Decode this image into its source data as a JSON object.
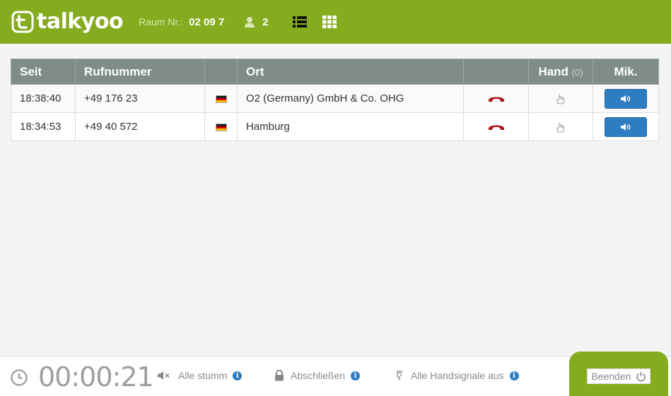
{
  "header": {
    "logo_text": "talkyoo",
    "room_label": "Raum Nr.:",
    "room_number": "02 09 7",
    "participant_count": "2"
  },
  "table": {
    "columns": {
      "seit": "Seit",
      "rufnummer": "Rufnummer",
      "flag": "",
      "ort": "Ort",
      "hangup": "",
      "hand": "Hand",
      "hand_count": "(0)",
      "mik": "Mik."
    },
    "rows": [
      {
        "seit": "18:38:40",
        "rufnummer": "+49 176 23",
        "ort": "O2 (Germany) GmbH & Co. OHG"
      },
      {
        "seit": "18:34:53",
        "rufnummer": "+49 40 572",
        "ort": "Hamburg"
      }
    ]
  },
  "footer": {
    "timer": "00:00:21",
    "mute_all": "Alle stumm",
    "lock": "Abschließen",
    "hands_off": "Alle Handsignale aus",
    "end": "Beenden",
    "info_glyph": "i"
  },
  "colors": {
    "brand_green": "#85ab1f",
    "header_gray": "#7f8c88",
    "mic_blue": "#2e7cc1",
    "hangup_red": "#b01010"
  }
}
